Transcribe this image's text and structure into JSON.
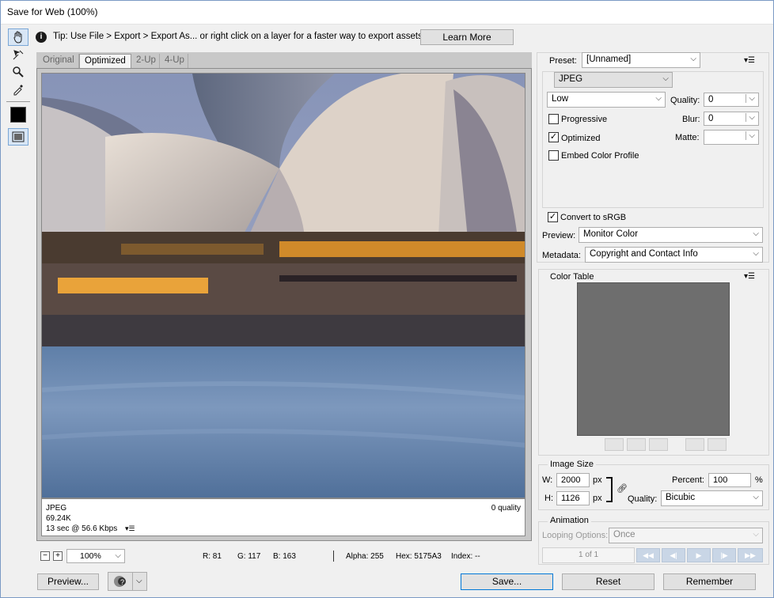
{
  "window": {
    "title": "Save for Web (100%)"
  },
  "tip": {
    "text": "Tip: Use File > Export > Export As...  or right click on a layer for a faster way to export assets",
    "learn_more": "Learn More"
  },
  "tabs": [
    "Original",
    "Optimized",
    "2-Up",
    "4-Up"
  ],
  "active_tab": "Optimized",
  "image_info": {
    "format": "JPEG",
    "size": "69.24K",
    "speed": "13 sec @ 56.6 Kbps",
    "quality": "0 quality"
  },
  "status": {
    "zoom": "100%",
    "r": "R: 81",
    "g": "G: 117",
    "b": "B: 163",
    "alpha": "Alpha: 255",
    "hex": "Hex: 5175A3",
    "index": "Index: --"
  },
  "buttons": {
    "preview": "Preview...",
    "save": "Save...",
    "reset": "Reset",
    "remember": "Remember"
  },
  "preset": {
    "label": "Preset:",
    "value": "[Unnamed]"
  },
  "format": {
    "value": "JPEG"
  },
  "compression": {
    "value": "Low"
  },
  "quality": {
    "label": "Quality:",
    "value": "0"
  },
  "blur": {
    "label": "Blur:",
    "value": "0"
  },
  "matte": {
    "label": "Matte:",
    "value": ""
  },
  "checkboxes": {
    "progressive": "Progressive",
    "optimized": "Optimized",
    "embed": "Embed Color Profile",
    "srgb": "Convert to sRGB"
  },
  "preview_sel": {
    "label": "Preview:",
    "value": "Monitor Color"
  },
  "metadata": {
    "label": "Metadata:",
    "value": "Copyright and Contact Info"
  },
  "color_table": {
    "label": "Color Table"
  },
  "image_size": {
    "label": "Image Size",
    "w_label": "W:",
    "w": "2000",
    "h_label": "H:",
    "h": "1126",
    "unit": "px",
    "percent_label": "Percent:",
    "percent": "100",
    "percent_unit": "%",
    "quality_label": "Quality:",
    "quality": "Bicubic"
  },
  "animation": {
    "label": "Animation",
    "looping_label": "Looping Options:",
    "looping": "Once",
    "frame": "1 of 1"
  },
  "colors": {
    "accent": "#7aa7d6",
    "checker": "#6e6e6e"
  }
}
